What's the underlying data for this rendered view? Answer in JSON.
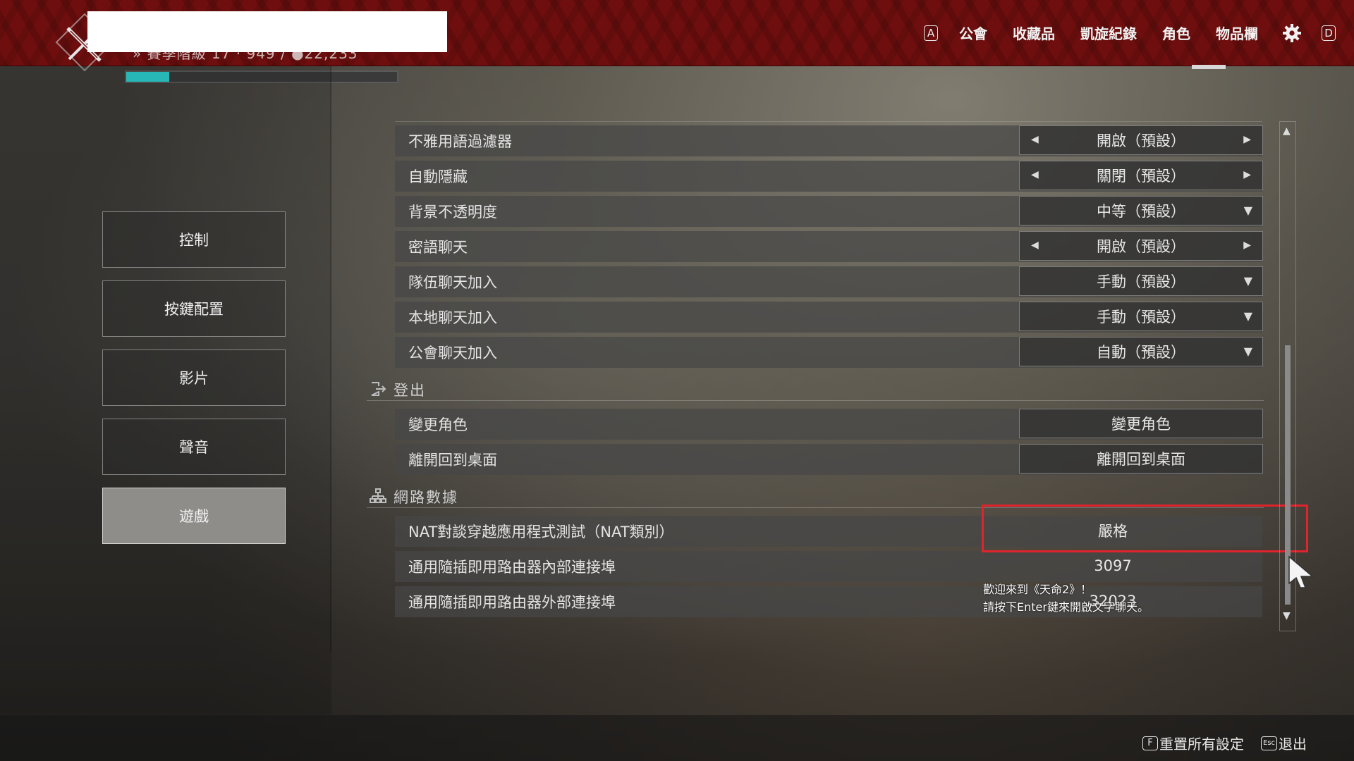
{
  "header": {
    "subline": "» 賽季階級 17 · 949 / ●22,233",
    "xp_progress_percent": 16,
    "nav_key_left": "A",
    "nav_items": [
      "公會",
      "收藏品",
      "凱旋紀錄",
      "角色",
      "物品欄"
    ],
    "nav_key_right": "D"
  },
  "sidebar": {
    "items": [
      {
        "label": "控制"
      },
      {
        "label": "按鍵配置"
      },
      {
        "label": "影片"
      },
      {
        "label": "聲音"
      },
      {
        "label": "遊戲",
        "active": true
      }
    ]
  },
  "settings": {
    "chat_rows": [
      {
        "label": "不雅用語過濾器",
        "value": "開啟（預設）",
        "control": "arrows"
      },
      {
        "label": "自動隱藏",
        "value": "關閉（預設）",
        "control": "arrows"
      },
      {
        "label": "背景不透明度",
        "value": "中等（預設）",
        "control": "dropdown"
      },
      {
        "label": "密語聊天",
        "value": "開啟（預設）",
        "control": "arrows"
      },
      {
        "label": "隊伍聊天加入",
        "value": "手動（預設）",
        "control": "dropdown"
      },
      {
        "label": "本地聊天加入",
        "value": "手動（預設）",
        "control": "dropdown"
      },
      {
        "label": "公會聊天加入",
        "value": "自動（預設）",
        "control": "dropdown"
      }
    ],
    "logout_section": {
      "title": "登出",
      "rows": [
        {
          "label": "變更角色",
          "button": "變更角色"
        },
        {
          "label": "離開回到桌面",
          "button": "離開回到桌面"
        }
      ]
    },
    "network_section": {
      "title": "網路數據",
      "rows": [
        {
          "label": "NAT對談穿越應用程式測試（NAT類別）",
          "value": "嚴格"
        },
        {
          "label": "通用隨插即用路由器內部連接埠",
          "value": "3097"
        },
        {
          "label": "通用隨插即用路由器外部連接埠",
          "value": "32023"
        }
      ]
    }
  },
  "chat_notice": {
    "line1": "歡迎來到《天命2》！",
    "line2": "請按下Enter鍵來開啟文字聊天。"
  },
  "footer": {
    "reset_key": "F",
    "reset_label": "重置所有設定",
    "exit_key": "Esc",
    "exit_label": "退出"
  },
  "colors": {
    "header_red": "#6e0e0e",
    "xp_fill": "#2fd3d3",
    "highlight": "#e0232d",
    "active_menu": "#8e8d89"
  },
  "icons": {
    "gear": "gear-icon",
    "logout": "logout-icon",
    "network": "network-icon",
    "cursor": "pointer-cursor-icon",
    "emblem": "clan-emblem-icon"
  }
}
